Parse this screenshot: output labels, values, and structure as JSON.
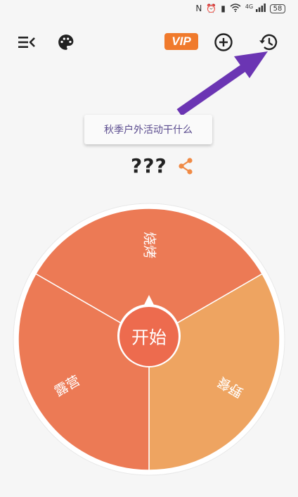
{
  "status_bar": {
    "battery": "58",
    "signal_label": "4G"
  },
  "toolbar": {
    "vip_label": "VIP"
  },
  "tooltip": {
    "text": "秋季户外活动干什么"
  },
  "result": {
    "text": "???"
  },
  "wheel": {
    "segments": [
      {
        "label": "烧烤",
        "color": "#ec7a55"
      },
      {
        "label": "野餐",
        "color": "#eea461"
      },
      {
        "label": "露营",
        "color": "#ec7a55"
      }
    ],
    "start_label": "开始"
  },
  "colors": {
    "accent": "#f07a2c",
    "start_button": "#ed6b4e",
    "arrow": "#6b35b3"
  }
}
